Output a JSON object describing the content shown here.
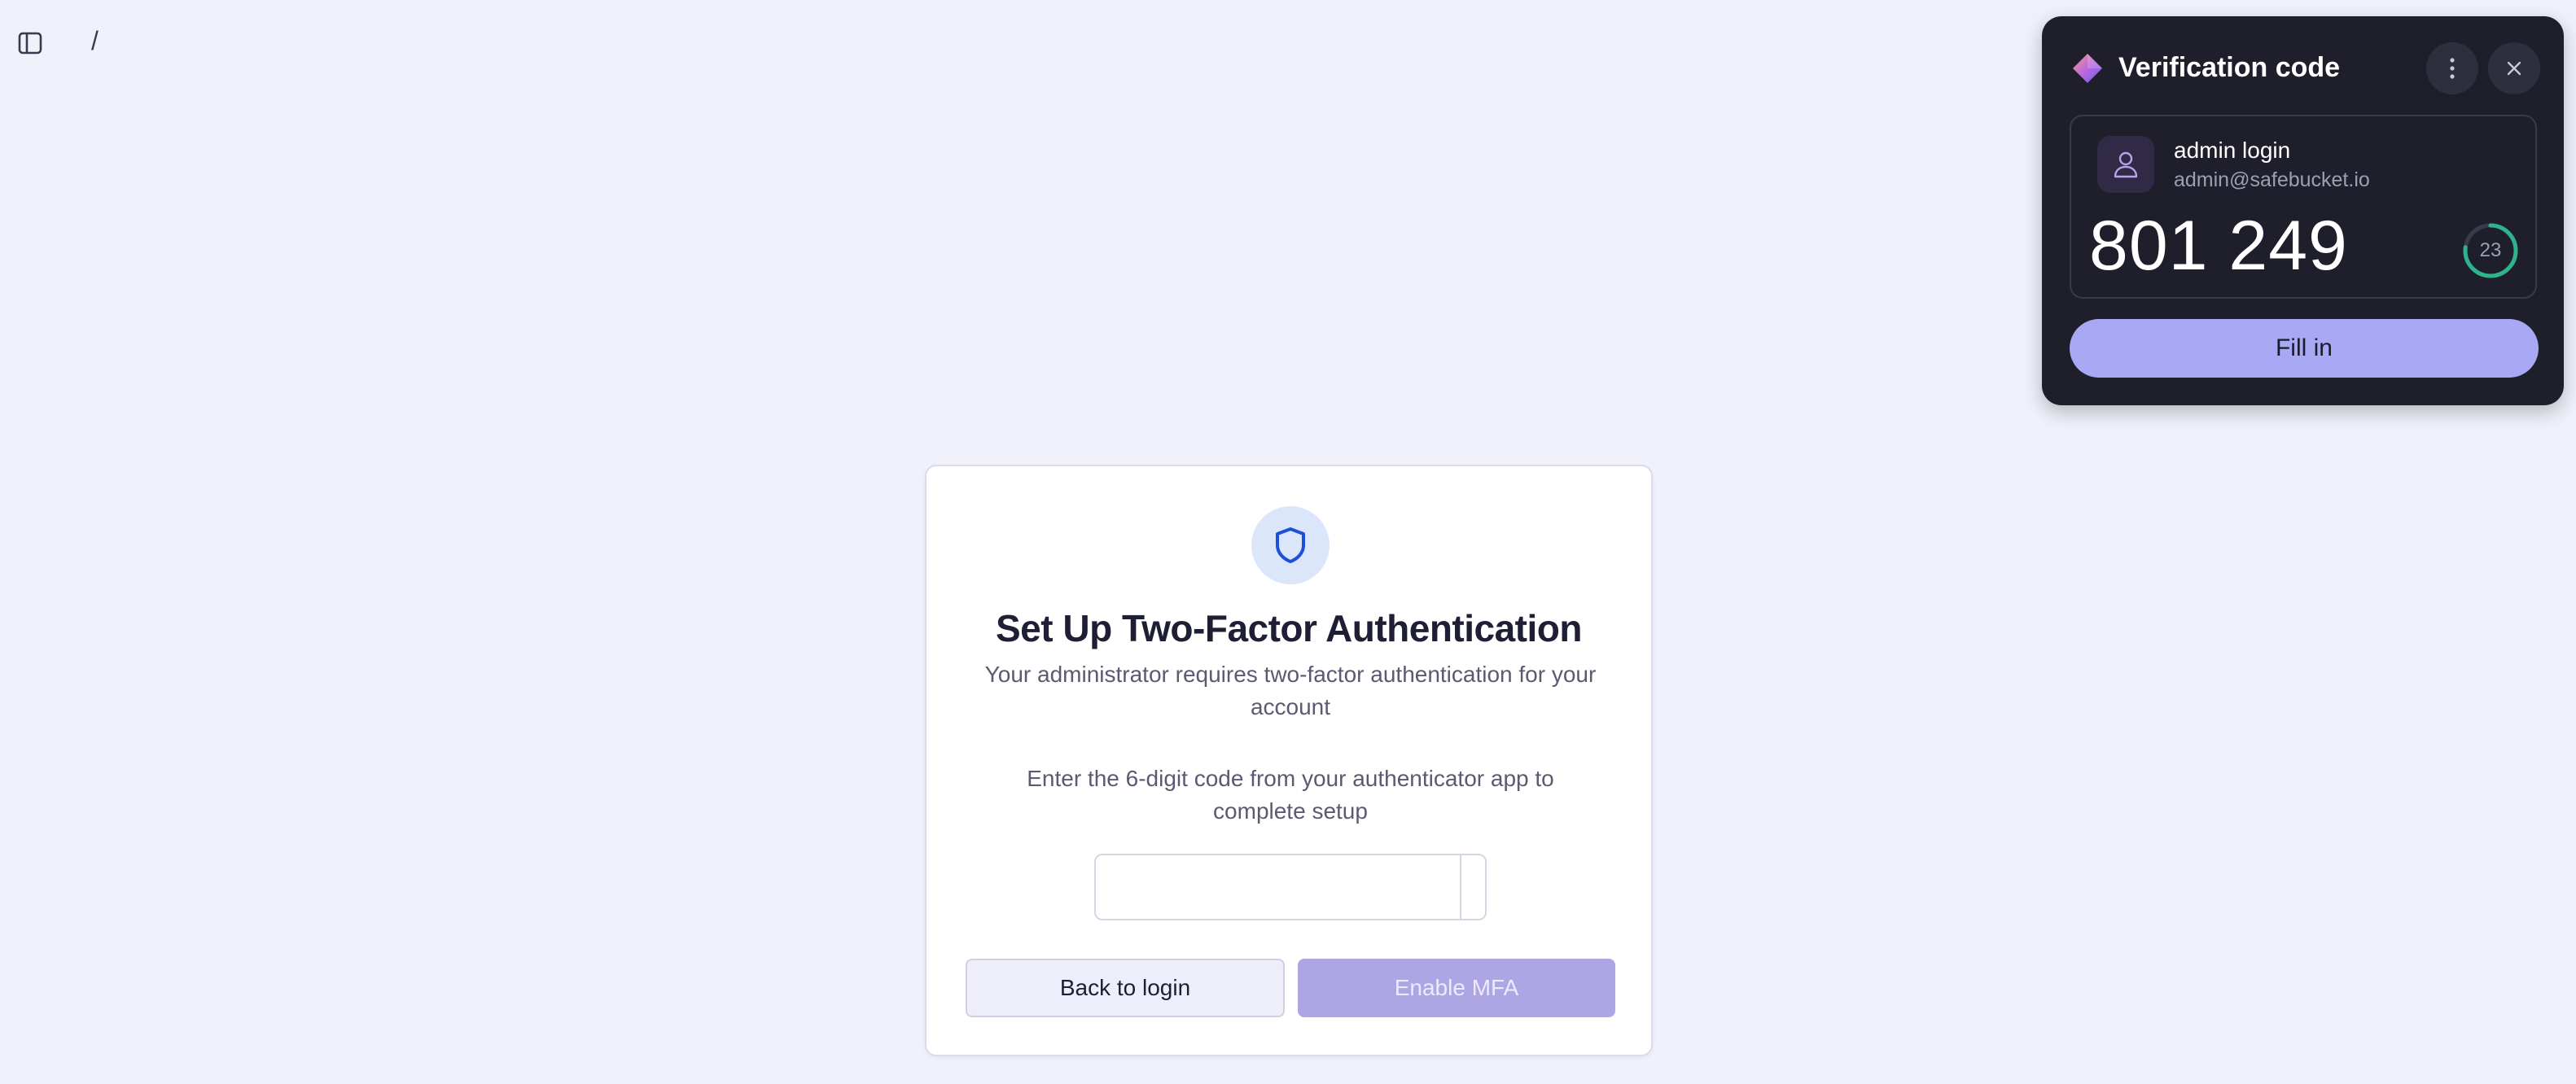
{
  "header": {
    "breadcrumb": "/"
  },
  "mfa_card": {
    "title": "Set Up Two-Factor Authentication",
    "subtitle": "Your administrator requires two-factor authentication for your account",
    "instruction": "Enter the 6-digit code from your authenticator app to complete setup",
    "digits": [
      "",
      "",
      "",
      "",
      "",
      ""
    ],
    "back_label": "Back to login",
    "enable_label": "Enable MFA"
  },
  "popup": {
    "title": "Verification code",
    "account_name": "admin login",
    "account_email": "admin@safebucket.io",
    "code": "801 249",
    "seconds_left": "23",
    "fill_label": "Fill in"
  },
  "colors": {
    "page_bg": "#f1f1fb",
    "accent": "#aea6e4",
    "shield": "#1d4fd8",
    "popup_bg": "#1f1f2c",
    "timer": "#2fb38a"
  },
  "icons": {
    "sidebar_toggle": "sidebar-toggle-icon",
    "shield": "shield-icon",
    "logo": "diamond-logo-icon",
    "menu": "more-vertical-icon",
    "close": "close-icon",
    "user": "user-icon"
  }
}
